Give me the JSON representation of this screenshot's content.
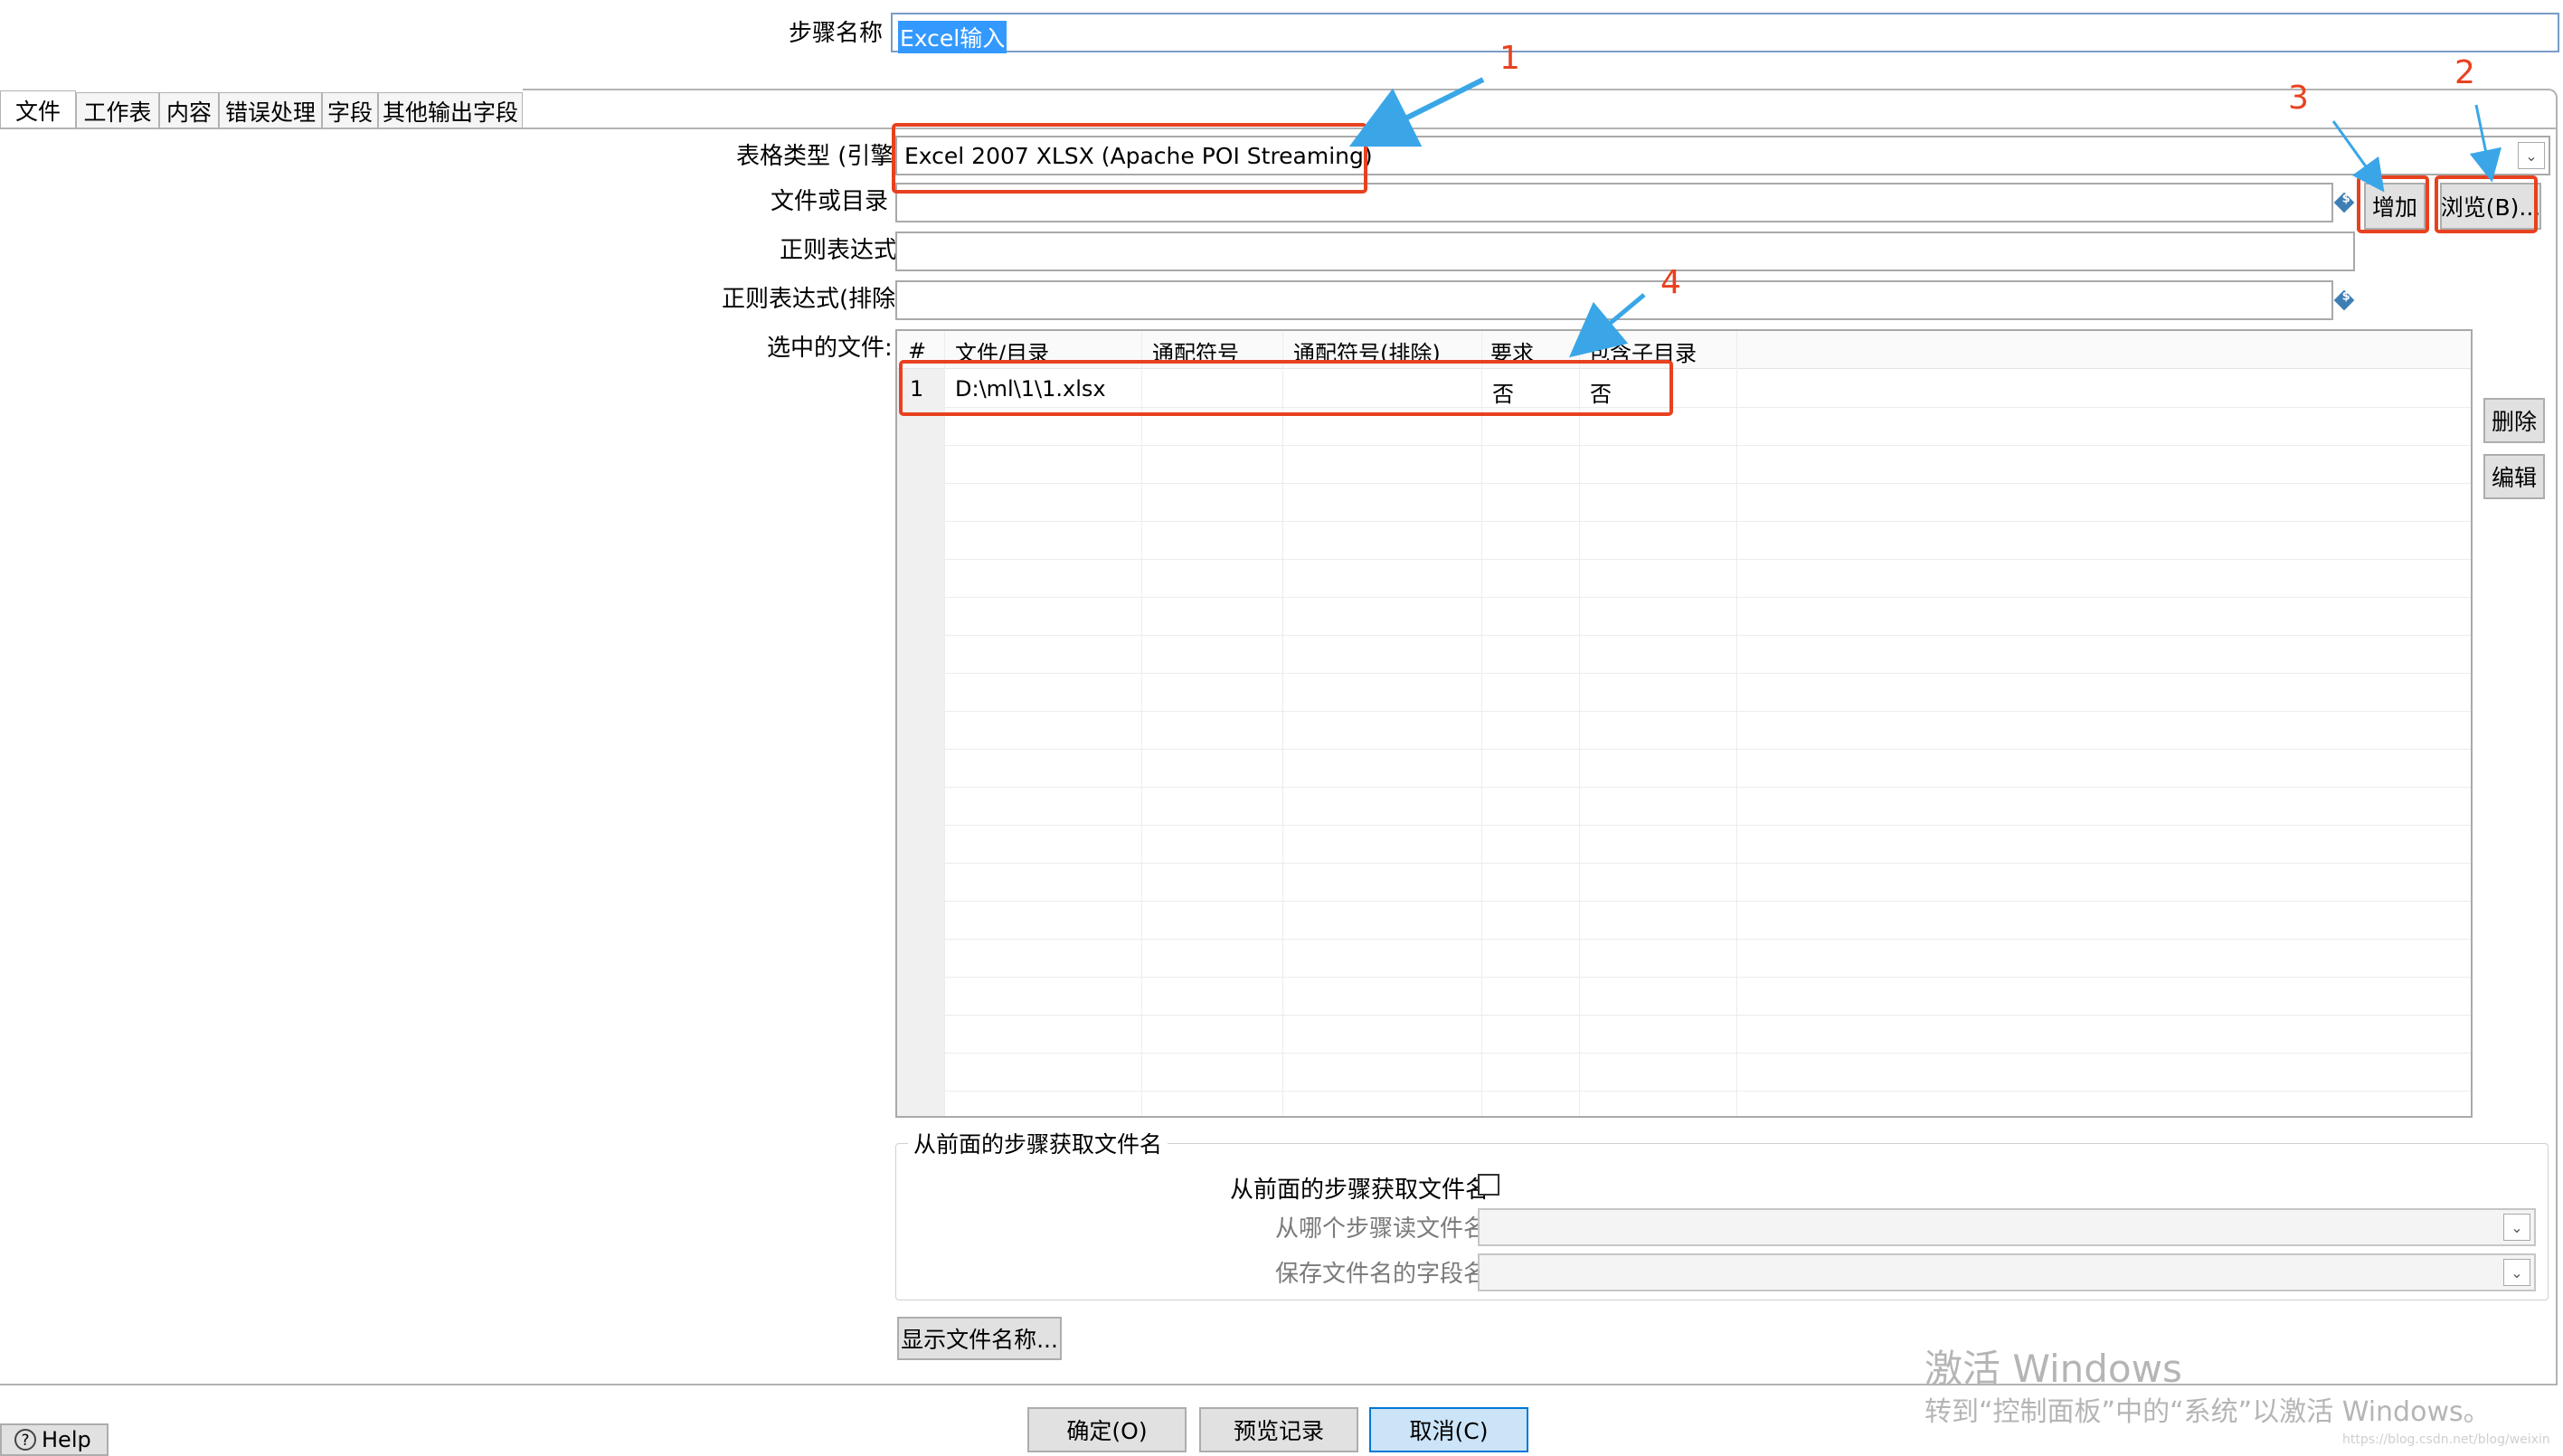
{
  "step_name": {
    "label": "步骤名称",
    "value": "Excel输入"
  },
  "tabs": [
    {
      "label": "文件"
    },
    {
      "label": "工作表"
    },
    {
      "label": "内容"
    },
    {
      "label": "错误处理"
    },
    {
      "label": "字段"
    },
    {
      "label": "其他输出字段"
    }
  ],
  "file_tab": {
    "spreadsheet_type": {
      "label": "表格类型 (引擎)",
      "value": "Excel 2007 XLSX (Apache POI Streaming)"
    },
    "file_or_dir": {
      "label": "文件或目录",
      "value": ""
    },
    "regex": {
      "label": "正则表达式",
      "value": ""
    },
    "regex_exclude": {
      "label": "正则表达式(排除)",
      "value": ""
    },
    "add_button": "增加",
    "browse_button": "浏览(B)...",
    "selected_files": {
      "label": "选中的文件:",
      "columns": [
        "#",
        "文件/目录",
        "通配符号",
        "通配符号(排除)",
        "要求",
        "包含子目录"
      ],
      "rows": [
        {
          "index": "1",
          "path": "D:\\ml\\1\\1.xlsx",
          "wildcard": "",
          "wildcard_exclude": "",
          "required": "否",
          "include_subdirs": "否"
        }
      ]
    },
    "delete_button": "删除",
    "edit_button": "编辑",
    "from_previous": {
      "group_title": "从前面的步骤获取文件名",
      "checkbox_label": "从前面的步骤获取文件名",
      "checked": false,
      "read_step_label": "从哪个步骤读文件名",
      "read_step_value": "",
      "field_name_label": "保存文件名的字段名",
      "field_name_value": ""
    },
    "show_filenames_button": "显示文件名称..."
  },
  "footer": {
    "help_button": "Help",
    "ok_button": "确定(O)",
    "preview_button": "预览记录",
    "cancel_button": "取消(C)"
  },
  "annotations": [
    "1",
    "2",
    "3",
    "4"
  ],
  "watermark": {
    "title": "激活 Windows",
    "subtitle": "转到“控制面板”中的“系统”以激活 Windows。",
    "url": "https://blog.csdn.net/blog/weixin"
  },
  "colors": {
    "annotation_red": "#e8411f",
    "arrow_blue": "#3aa6e8",
    "selection_blue": "#0078d7"
  }
}
